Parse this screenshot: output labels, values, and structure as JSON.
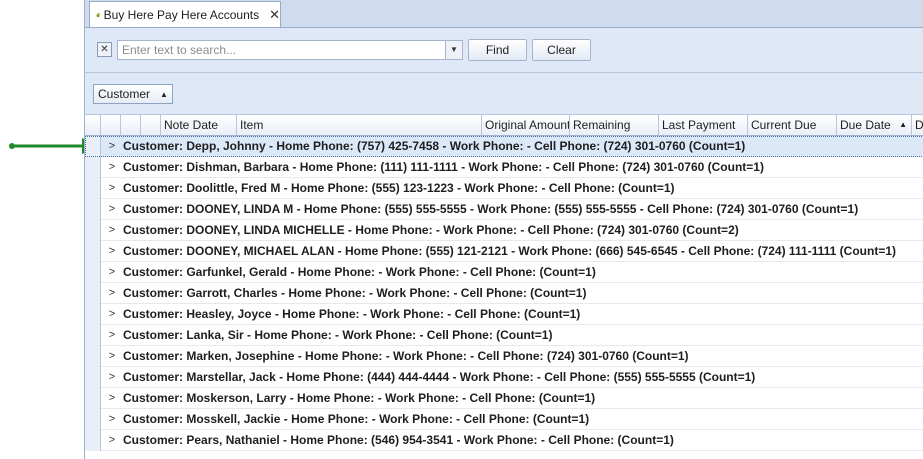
{
  "tab": {
    "title": "Buy Here Pay Here Accounts",
    "close_glyph": "✕",
    "icon": "money-bag-icon"
  },
  "search": {
    "placeholder": "Enter text to search...",
    "value": "",
    "find_label": "Find",
    "clear_label": "Clear",
    "clear_glyph": "✕",
    "dropdown_glyph": "▼"
  },
  "group_panel": {
    "group_label": "Customer",
    "sort_glyph": "▲"
  },
  "columns": [
    "Note Date",
    "Item",
    "Original Amount",
    "Remaining",
    "Last Payment",
    "Current Due",
    "Due Date",
    "D"
  ],
  "due_date_sort_glyph": "▲",
  "expand_glyph": ">",
  "rows": [
    "Customer: Depp, Johnny  - Home Phone: (757) 425-7458  - Work Phone:   - Cell Phone: (724) 301-0760  (Count=1)",
    "Customer: Dishman, Barbara  - Home Phone: (111) 111-1111  - Work Phone:   - Cell Phone: (724) 301-0760  (Count=1)",
    "Customer: Doolittle, Fred M  - Home Phone: (555) 123-1223  - Work Phone:   - Cell Phone:   (Count=1)",
    "Customer: DOONEY, LINDA M  - Home Phone: (555) 555-5555  - Work Phone: (555) 555-5555  - Cell Phone: (724) 301-0760  (Count=1)",
    "Customer: DOONEY, LINDA MICHELLE  - Home Phone:   - Work Phone:   - Cell Phone: (724) 301-0760  (Count=2)",
    "Customer: DOONEY, MICHAEL ALAN  - Home Phone: (555) 121-2121  - Work Phone: (666) 545-6545  - Cell Phone: (724) 111-1111  (Count=1)",
    "Customer: Garfunkel, Gerald  - Home Phone:   - Work Phone:   - Cell Phone:   (Count=1)",
    "Customer: Garrott, Charles  - Home Phone:   - Work Phone:   - Cell Phone:   (Count=1)",
    "Customer: Heasley, Joyce  - Home Phone:   - Work Phone:   - Cell Phone:   (Count=1)",
    "Customer: Lanka, Sir  - Home Phone:   - Work Phone:   - Cell Phone:   (Count=1)",
    "Customer: Marken, Josephine  - Home Phone:   - Work Phone:   - Cell Phone: (724) 301-0760  (Count=1)",
    "Customer: Marstellar, Jack  - Home Phone: (444) 444-4444  - Work Phone:   - Cell Phone: (555) 555-5555  (Count=1)",
    "Customer: Moskerson, Larry  - Home Phone:   - Work Phone:   - Cell Phone:   (Count=1)",
    "Customer: Mosskell, Jackie  - Home Phone:   - Work Phone:   - Cell Phone:   (Count=1)",
    "Customer: Pears, Nathaniel  - Home Phone: (546) 954-3541  - Work Phone:   - Cell Phone:   (Count=1)"
  ],
  "colors": {
    "annotation_arrow": "#1f8a2a",
    "selected_row": "#dbe8f8",
    "panel_bg": "#dfe8f6"
  }
}
